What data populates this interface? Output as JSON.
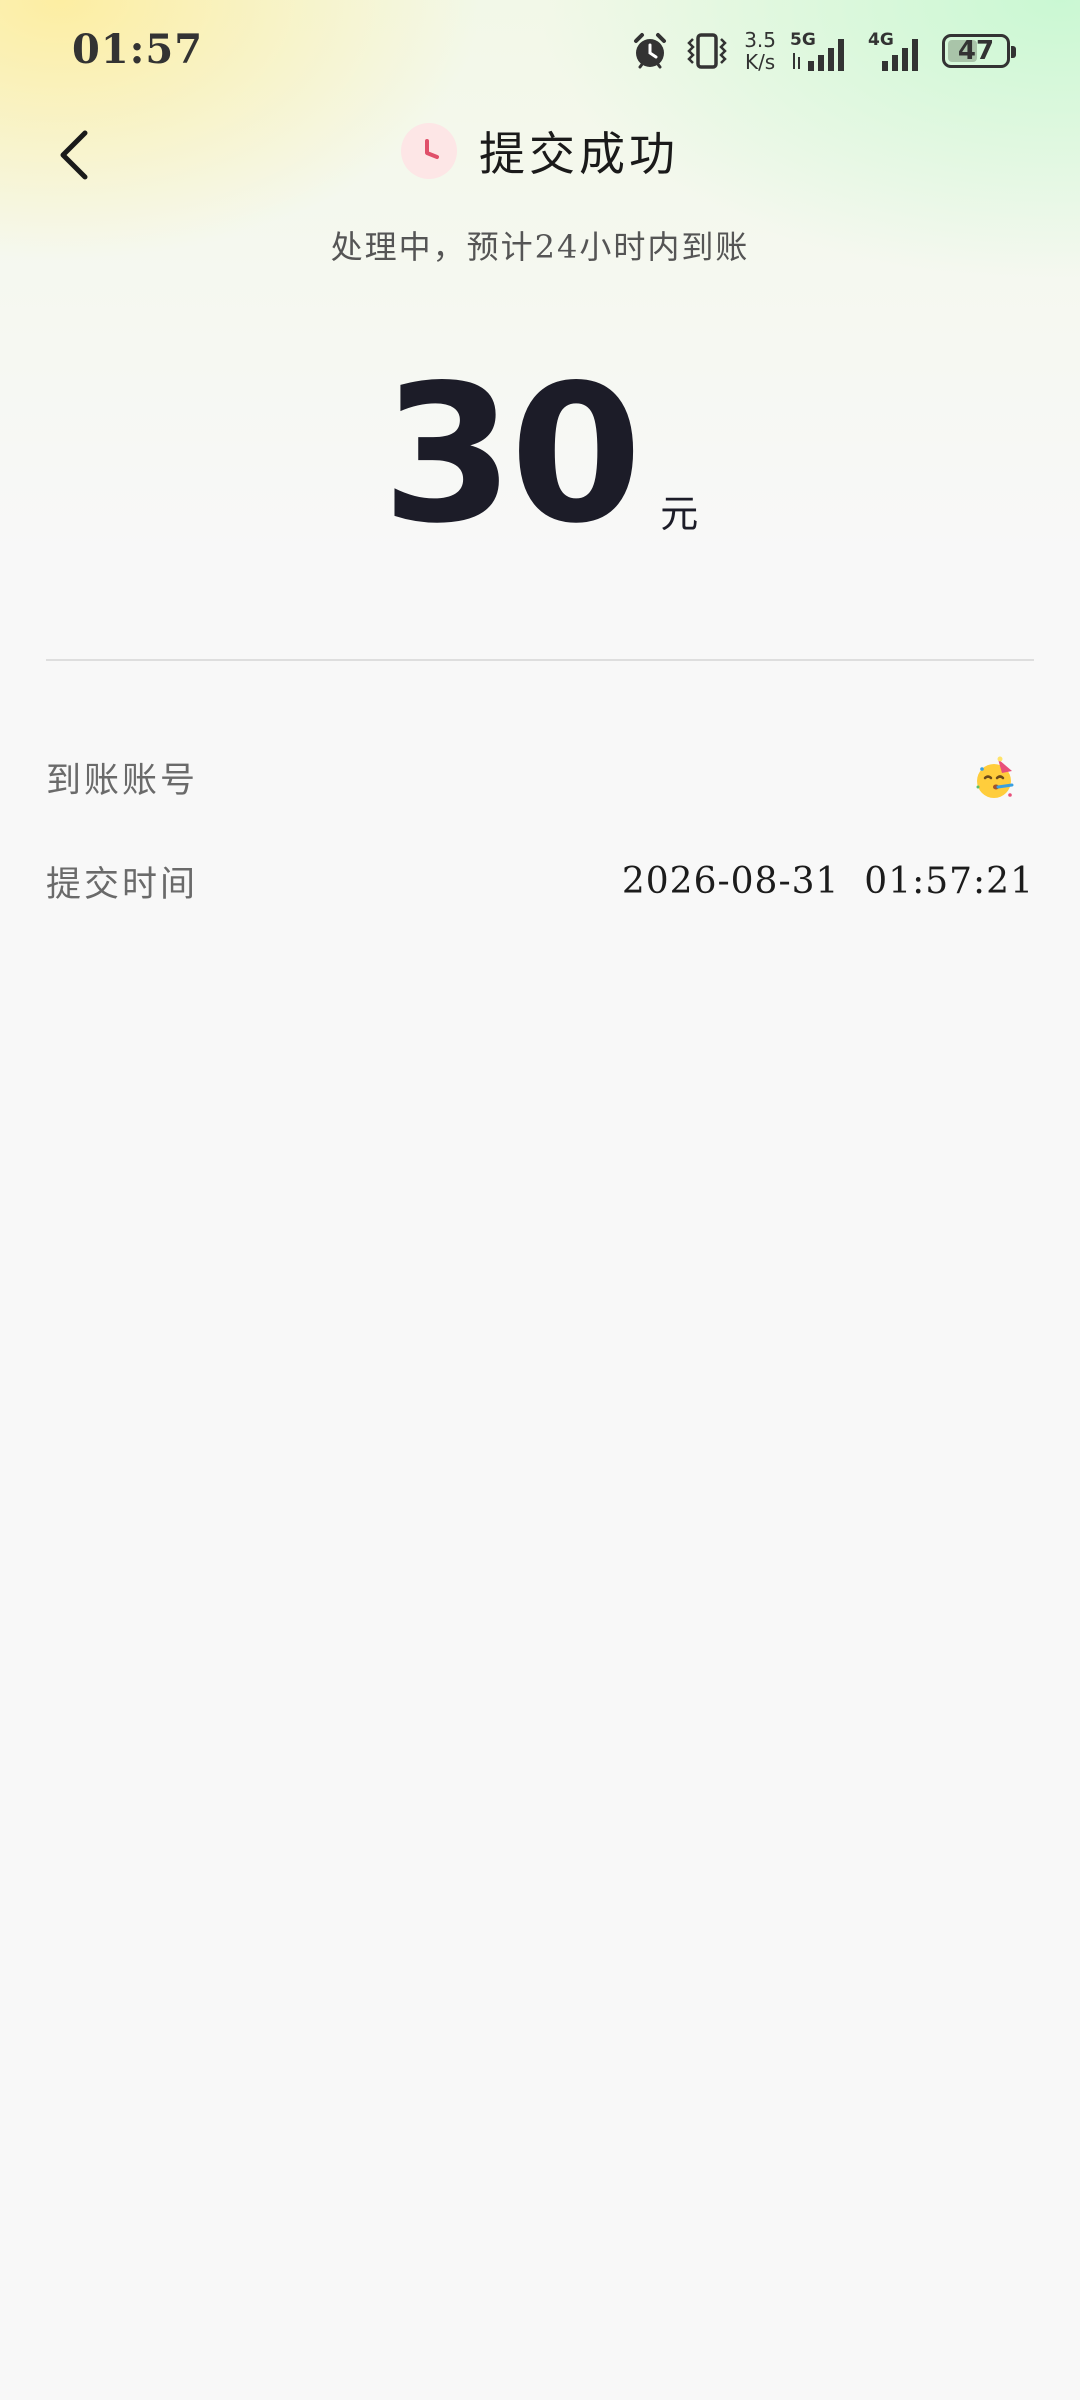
{
  "status_bar": {
    "time": "01:57",
    "speed_value": "3.5",
    "speed_unit": "K/s",
    "network_5g": "5G",
    "network_4g": "4G",
    "battery": "47",
    "icons": [
      "alarm-icon",
      "vibrate-icon",
      "signal-5g-icon",
      "signal-4g-icon",
      "battery-icon"
    ]
  },
  "header": {
    "title": "提交成功",
    "subtitle": "处理中，预计24小时内到账",
    "status_icon": "clock-icon",
    "back_icon": "chevron-left-icon"
  },
  "amount": {
    "value": "30",
    "unit": "元"
  },
  "details": [
    {
      "label": "到账账号",
      "value_icon": "party-face-emoji"
    },
    {
      "label": "提交时间",
      "value": "2026-08-31  01:57:21"
    }
  ],
  "colors": {
    "text_primary": "#1c1c28",
    "text_secondary": "#6a6a6a",
    "clock_accent": "#e0506a",
    "clock_badge_bg": "#fde6e6",
    "background": "#f8f8f8"
  }
}
